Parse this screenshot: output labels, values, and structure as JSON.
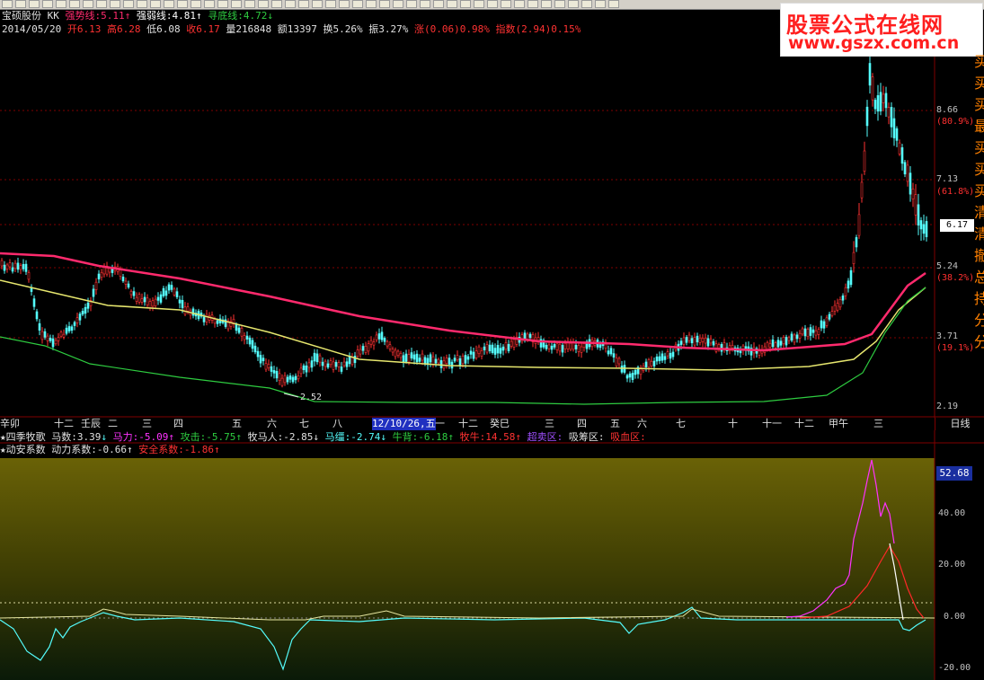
{
  "header": {
    "stock_name": "宝硕股份",
    "indicator_code": "KK",
    "strong_line_label": "强势线:",
    "strong_line_value": "5.11",
    "weak_line_label": "强弱线:",
    "weak_line_value": "4.81",
    "bottom_line_label": "寻底线:",
    "bottom_line_value": "4.72"
  },
  "quote": {
    "date": "2014/05/20",
    "open": "开6.13",
    "high": "高6.28",
    "low": "低6.08",
    "close": "收6.17",
    "volume": "量216848",
    "amount": "额13397",
    "turnover": "换5.26%",
    "amplitude": "振3.27%",
    "change": "涨(0.06)0.98%",
    "index": "指数(2.94)0.15%"
  },
  "price_axis": [
    {
      "value": "8.66",
      "pct": "(80.9%)"
    },
    {
      "value": "7.13",
      "pct": "(61.8%)"
    },
    {
      "value": "5.24",
      "pct": "(38.2%)"
    },
    {
      "value": "3.71",
      "pct": "(19.1%)"
    },
    {
      "value": "2.19",
      "pct": ""
    }
  ],
  "current_price": "6.17",
  "low_marker": "2.52",
  "timeline": {
    "labels": [
      "辛卯",
      "十二",
      "壬辰",
      "二",
      "三",
      "四",
      "五",
      "六",
      "七",
      "八",
      "12/10/26,五",
      "一",
      "十二",
      "癸巳",
      "三",
      "四",
      "五",
      "六",
      "七",
      "十",
      "十一",
      "十二",
      "甲午",
      "三"
    ],
    "period": "日线"
  },
  "indicator1": {
    "name": "★四季牧歌",
    "items": [
      "马数:3.39",
      "马力:-5.09",
      "攻击:-5.75",
      "牧马人:-2.85",
      "马缰:-2.74",
      "牛背:-6.18",
      "牧牛:14.58",
      "超卖区:",
      "吸筹区:",
      "吸血区:"
    ]
  },
  "indicator2": {
    "name": "★动安系数",
    "items": [
      "动力系数:-0.66",
      "安全系数:-1.86"
    ]
  },
  "indicator_axis": [
    "40.00",
    "20.00",
    "0.00",
    "-20.00"
  ],
  "indicator_current": "52.68",
  "watermark": {
    "line1": "股票公式在线网",
    "line2": "www.gszx.com.cn"
  },
  "right_strip_chars": [
    "买",
    "买",
    "买",
    "最",
    "买",
    "买",
    "买",
    "清",
    "清",
    "撤",
    "总",
    "持",
    "分",
    "分"
  ],
  "colors": {
    "up": "#ff3232",
    "down": "#54fcfc",
    "strong_line": "#ff2a6d",
    "weak_line": "#e6e66e",
    "bottom_line": "#2ecc40",
    "grid": "#800000"
  }
}
